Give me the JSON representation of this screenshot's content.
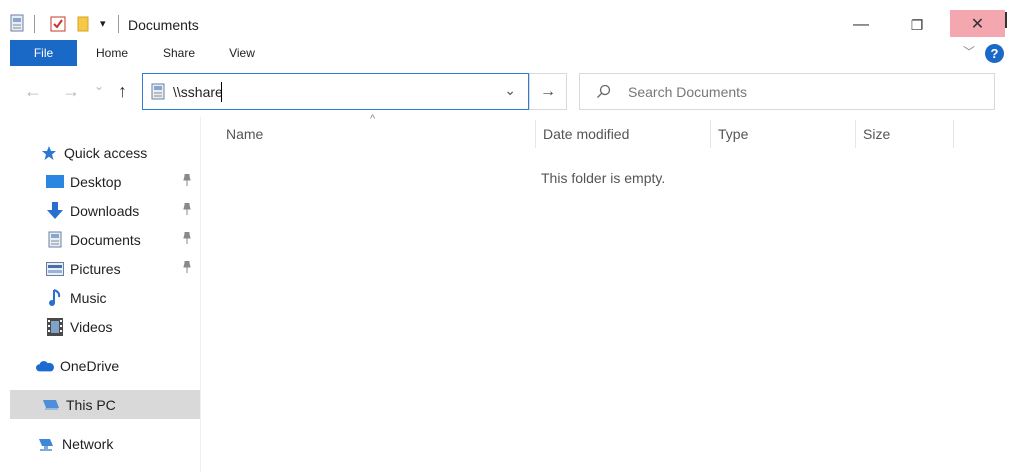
{
  "window": {
    "title": "Documents",
    "close_glyph": "✕",
    "restore_glyph": "❐",
    "minimize_glyph": "—",
    "qat_dropdown": "▾"
  },
  "ribbon": {
    "tabs": [
      "File",
      "Home",
      "Share",
      "View"
    ],
    "help": "?",
    "collapse": "﹀"
  },
  "navbar": {
    "back": "←",
    "forward": "→",
    "recent": "⌄",
    "up": "↑",
    "address_value": "\\\\sshare",
    "address_dropdown": "⌄",
    "go": "→",
    "search_placeholder": "Search Documents"
  },
  "sidebar": {
    "quick_access": "Quick access",
    "items": [
      {
        "label": "Desktop",
        "icon": "desktop-icon",
        "pinned": true
      },
      {
        "label": "Downloads",
        "icon": "download-icon",
        "pinned": true
      },
      {
        "label": "Documents",
        "icon": "documents-icon",
        "pinned": true
      },
      {
        "label": "Pictures",
        "icon": "pictures-icon",
        "pinned": true
      },
      {
        "label": "Music",
        "icon": "music-icon",
        "pinned": false
      },
      {
        "label": "Videos",
        "icon": "videos-icon",
        "pinned": false
      }
    ],
    "onedrive": "OneDrive",
    "this_pc": "This PC",
    "network": "Network",
    "pin_glyph": "📌"
  },
  "content": {
    "columns": [
      "Name",
      "Date modified",
      "Type",
      "Size"
    ],
    "empty_message": "This folder is empty."
  },
  "colors": {
    "accent": "#1b69c7",
    "close_hover": "#f4a7ae",
    "selected_bg": "#d9d9d9"
  }
}
